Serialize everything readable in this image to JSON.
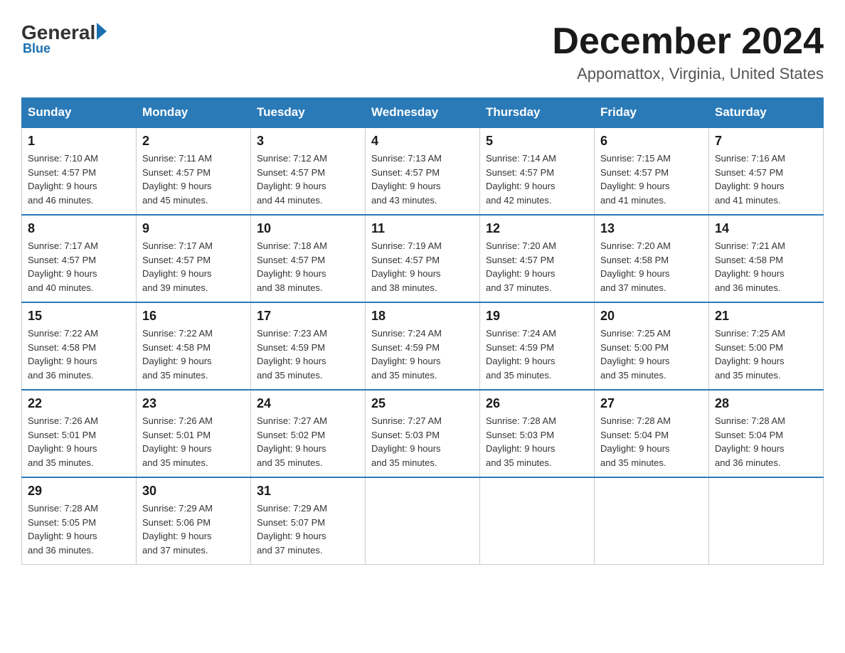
{
  "header": {
    "logo": {
      "general": "General",
      "arrow": "▶",
      "blue": "Blue"
    },
    "title": "December 2024",
    "subtitle": "Appomattox, Virginia, United States"
  },
  "days_of_week": [
    "Sunday",
    "Monday",
    "Tuesday",
    "Wednesday",
    "Thursday",
    "Friday",
    "Saturday"
  ],
  "weeks": [
    [
      {
        "day": "1",
        "sunrise": "7:10 AM",
        "sunset": "4:57 PM",
        "daylight": "9 hours and 46 minutes."
      },
      {
        "day": "2",
        "sunrise": "7:11 AM",
        "sunset": "4:57 PM",
        "daylight": "9 hours and 45 minutes."
      },
      {
        "day": "3",
        "sunrise": "7:12 AM",
        "sunset": "4:57 PM",
        "daylight": "9 hours and 44 minutes."
      },
      {
        "day": "4",
        "sunrise": "7:13 AM",
        "sunset": "4:57 PM",
        "daylight": "9 hours and 43 minutes."
      },
      {
        "day": "5",
        "sunrise": "7:14 AM",
        "sunset": "4:57 PM",
        "daylight": "9 hours and 42 minutes."
      },
      {
        "day": "6",
        "sunrise": "7:15 AM",
        "sunset": "4:57 PM",
        "daylight": "9 hours and 41 minutes."
      },
      {
        "day": "7",
        "sunrise": "7:16 AM",
        "sunset": "4:57 PM",
        "daylight": "9 hours and 41 minutes."
      }
    ],
    [
      {
        "day": "8",
        "sunrise": "7:17 AM",
        "sunset": "4:57 PM",
        "daylight": "9 hours and 40 minutes."
      },
      {
        "day": "9",
        "sunrise": "7:17 AM",
        "sunset": "4:57 PM",
        "daylight": "9 hours and 39 minutes."
      },
      {
        "day": "10",
        "sunrise": "7:18 AM",
        "sunset": "4:57 PM",
        "daylight": "9 hours and 38 minutes."
      },
      {
        "day": "11",
        "sunrise": "7:19 AM",
        "sunset": "4:57 PM",
        "daylight": "9 hours and 38 minutes."
      },
      {
        "day": "12",
        "sunrise": "7:20 AM",
        "sunset": "4:57 PM",
        "daylight": "9 hours and 37 minutes."
      },
      {
        "day": "13",
        "sunrise": "7:20 AM",
        "sunset": "4:58 PM",
        "daylight": "9 hours and 37 minutes."
      },
      {
        "day": "14",
        "sunrise": "7:21 AM",
        "sunset": "4:58 PM",
        "daylight": "9 hours and 36 minutes."
      }
    ],
    [
      {
        "day": "15",
        "sunrise": "7:22 AM",
        "sunset": "4:58 PM",
        "daylight": "9 hours and 36 minutes."
      },
      {
        "day": "16",
        "sunrise": "7:22 AM",
        "sunset": "4:58 PM",
        "daylight": "9 hours and 35 minutes."
      },
      {
        "day": "17",
        "sunrise": "7:23 AM",
        "sunset": "4:59 PM",
        "daylight": "9 hours and 35 minutes."
      },
      {
        "day": "18",
        "sunrise": "7:24 AM",
        "sunset": "4:59 PM",
        "daylight": "9 hours and 35 minutes."
      },
      {
        "day": "19",
        "sunrise": "7:24 AM",
        "sunset": "4:59 PM",
        "daylight": "9 hours and 35 minutes."
      },
      {
        "day": "20",
        "sunrise": "7:25 AM",
        "sunset": "5:00 PM",
        "daylight": "9 hours and 35 minutes."
      },
      {
        "day": "21",
        "sunrise": "7:25 AM",
        "sunset": "5:00 PM",
        "daylight": "9 hours and 35 minutes."
      }
    ],
    [
      {
        "day": "22",
        "sunrise": "7:26 AM",
        "sunset": "5:01 PM",
        "daylight": "9 hours and 35 minutes."
      },
      {
        "day": "23",
        "sunrise": "7:26 AM",
        "sunset": "5:01 PM",
        "daylight": "9 hours and 35 minutes."
      },
      {
        "day": "24",
        "sunrise": "7:27 AM",
        "sunset": "5:02 PM",
        "daylight": "9 hours and 35 minutes."
      },
      {
        "day": "25",
        "sunrise": "7:27 AM",
        "sunset": "5:03 PM",
        "daylight": "9 hours and 35 minutes."
      },
      {
        "day": "26",
        "sunrise": "7:28 AM",
        "sunset": "5:03 PM",
        "daylight": "9 hours and 35 minutes."
      },
      {
        "day": "27",
        "sunrise": "7:28 AM",
        "sunset": "5:04 PM",
        "daylight": "9 hours and 35 minutes."
      },
      {
        "day": "28",
        "sunrise": "7:28 AM",
        "sunset": "5:04 PM",
        "daylight": "9 hours and 36 minutes."
      }
    ],
    [
      {
        "day": "29",
        "sunrise": "7:28 AM",
        "sunset": "5:05 PM",
        "daylight": "9 hours and 36 minutes."
      },
      {
        "day": "30",
        "sunrise": "7:29 AM",
        "sunset": "5:06 PM",
        "daylight": "9 hours and 37 minutes."
      },
      {
        "day": "31",
        "sunrise": "7:29 AM",
        "sunset": "5:07 PM",
        "daylight": "9 hours and 37 minutes."
      },
      null,
      null,
      null,
      null
    ]
  ],
  "labels": {
    "sunrise_prefix": "Sunrise: ",
    "sunset_prefix": "Sunset: ",
    "daylight_prefix": "Daylight: "
  }
}
